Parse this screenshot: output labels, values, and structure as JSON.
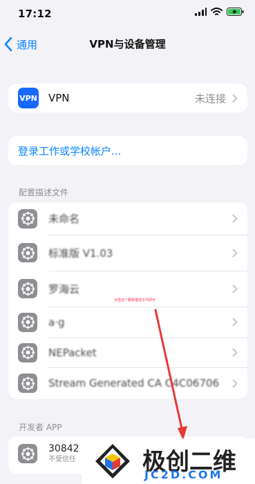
{
  "status_bar": {
    "time": "17:12"
  },
  "nav": {
    "back_label": "通用",
    "title": "VPN与设备管理"
  },
  "vpn": {
    "icon_text": "VPN",
    "label": "VPN",
    "value": "未连接"
  },
  "account": {
    "label": "登录工作或学校帐户..."
  },
  "profiles": {
    "header": "配置描述文件",
    "items": [
      {
        "label": "未命名"
      },
      {
        "label": "标准版 V1.03"
      },
      {
        "label": "罗海云"
      },
      {
        "label": "a·g"
      },
      {
        "label": "NEPacket"
      },
      {
        "label": "Stream Generated CA C4C06706"
      }
    ]
  },
  "annotation": {
    "text": "点击这个删除描述文件即可"
  },
  "developer": {
    "header": "开发者 APP",
    "items": [
      {
        "name": "30842",
        "subtitle": "不受信任"
      }
    ]
  },
  "watermark": {
    "title": "极创二维",
    "domain": "JC2D.COM"
  },
  "icons": {
    "back": "chevron-left-icon",
    "chevron": "chevron-right-icon",
    "profile": "gear-icon",
    "signal": "signal-icon",
    "wifi": "wifi-icon",
    "battery": "battery-icon"
  },
  "colors": {
    "accent": "#0A84FF",
    "vpn_icon": "#1769FF",
    "gear": "#8E8E93",
    "battery": "#34C759",
    "annotation": "#FF2D55",
    "watermark_blue": "#1F77E6"
  }
}
